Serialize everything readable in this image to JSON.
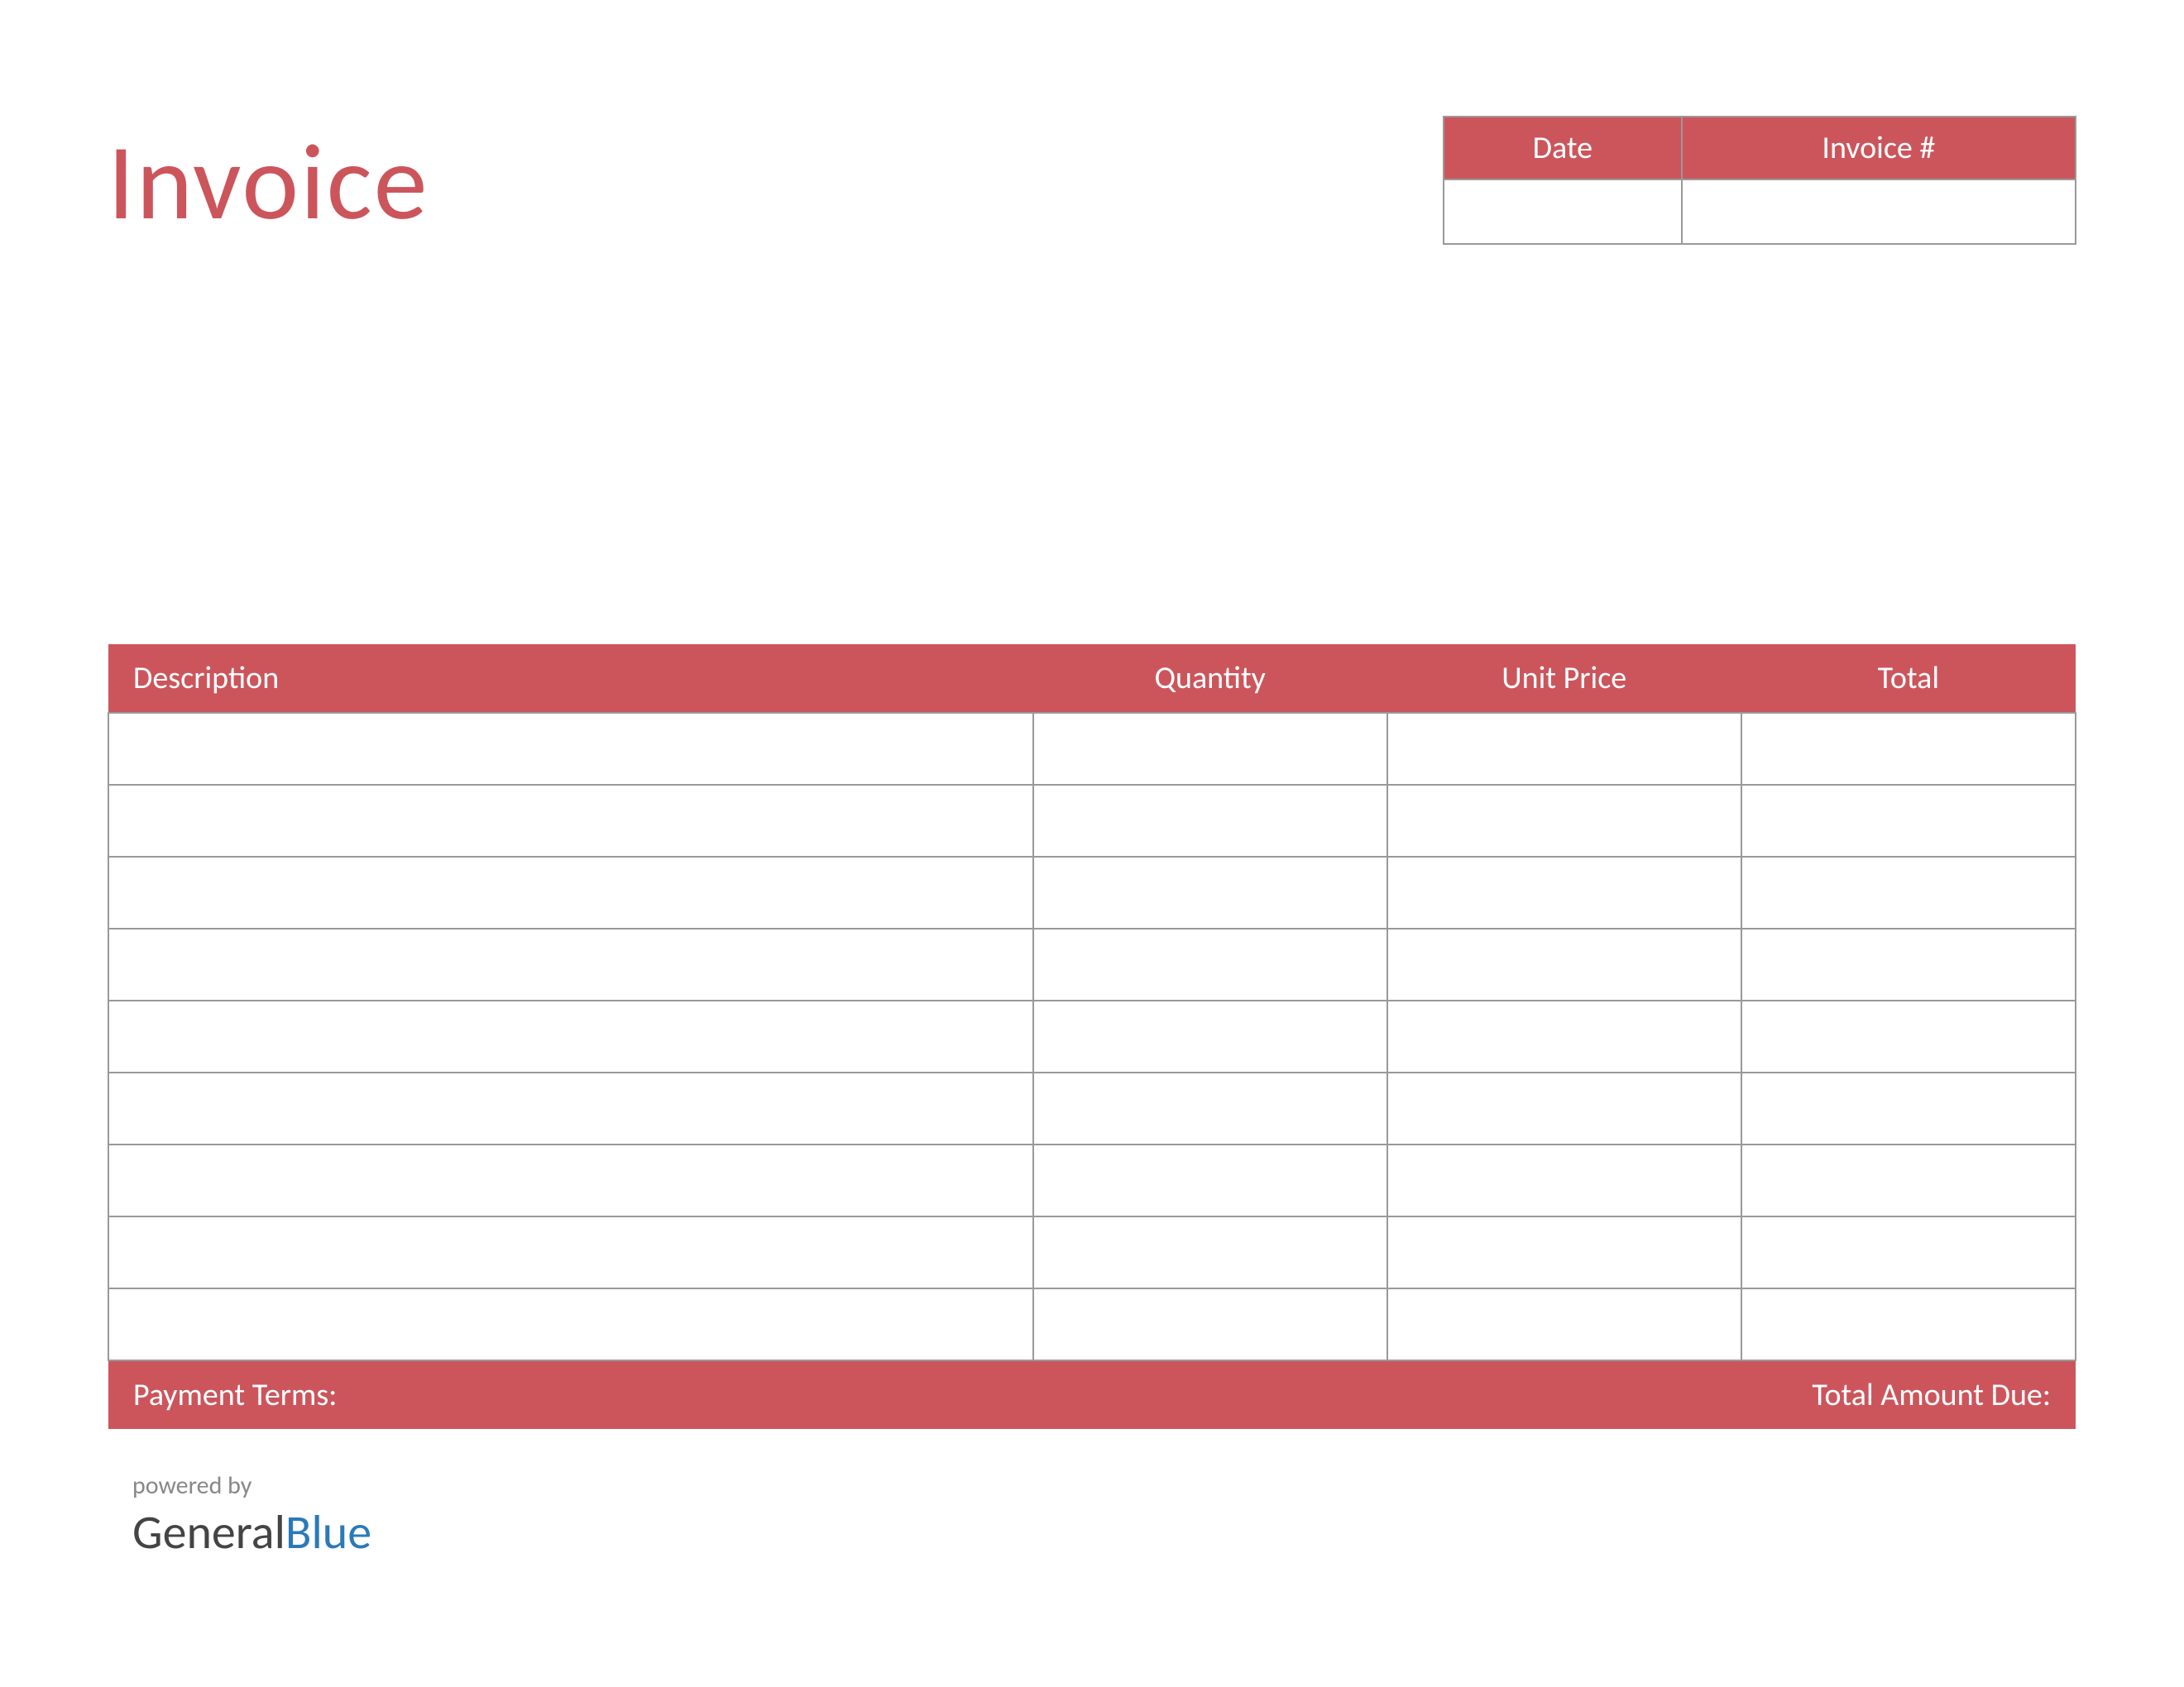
{
  "title": "Invoice",
  "meta": {
    "date_header": "Date",
    "invoice_number_header": "Invoice #",
    "date_value": "",
    "invoice_number_value": ""
  },
  "columns": {
    "description": "Description",
    "quantity": "Quantity",
    "unit_price": "Unit Price",
    "total": "Total"
  },
  "rows": [
    {
      "description": "",
      "quantity": "",
      "unit_price": "",
      "total": ""
    },
    {
      "description": "",
      "quantity": "",
      "unit_price": "",
      "total": ""
    },
    {
      "description": "",
      "quantity": "",
      "unit_price": "",
      "total": ""
    },
    {
      "description": "",
      "quantity": "",
      "unit_price": "",
      "total": ""
    },
    {
      "description": "",
      "quantity": "",
      "unit_price": "",
      "total": ""
    },
    {
      "description": "",
      "quantity": "",
      "unit_price": "",
      "total": ""
    },
    {
      "description": "",
      "quantity": "",
      "unit_price": "",
      "total": ""
    },
    {
      "description": "",
      "quantity": "",
      "unit_price": "",
      "total": ""
    },
    {
      "description": "",
      "quantity": "",
      "unit_price": "",
      "total": ""
    }
  ],
  "footer": {
    "payment_terms_label": "Payment Terms:",
    "total_due_label": "Total Amount Due:"
  },
  "brand": {
    "powered_by": "powered by",
    "name_part1": "General",
    "name_part2": "Blue"
  }
}
